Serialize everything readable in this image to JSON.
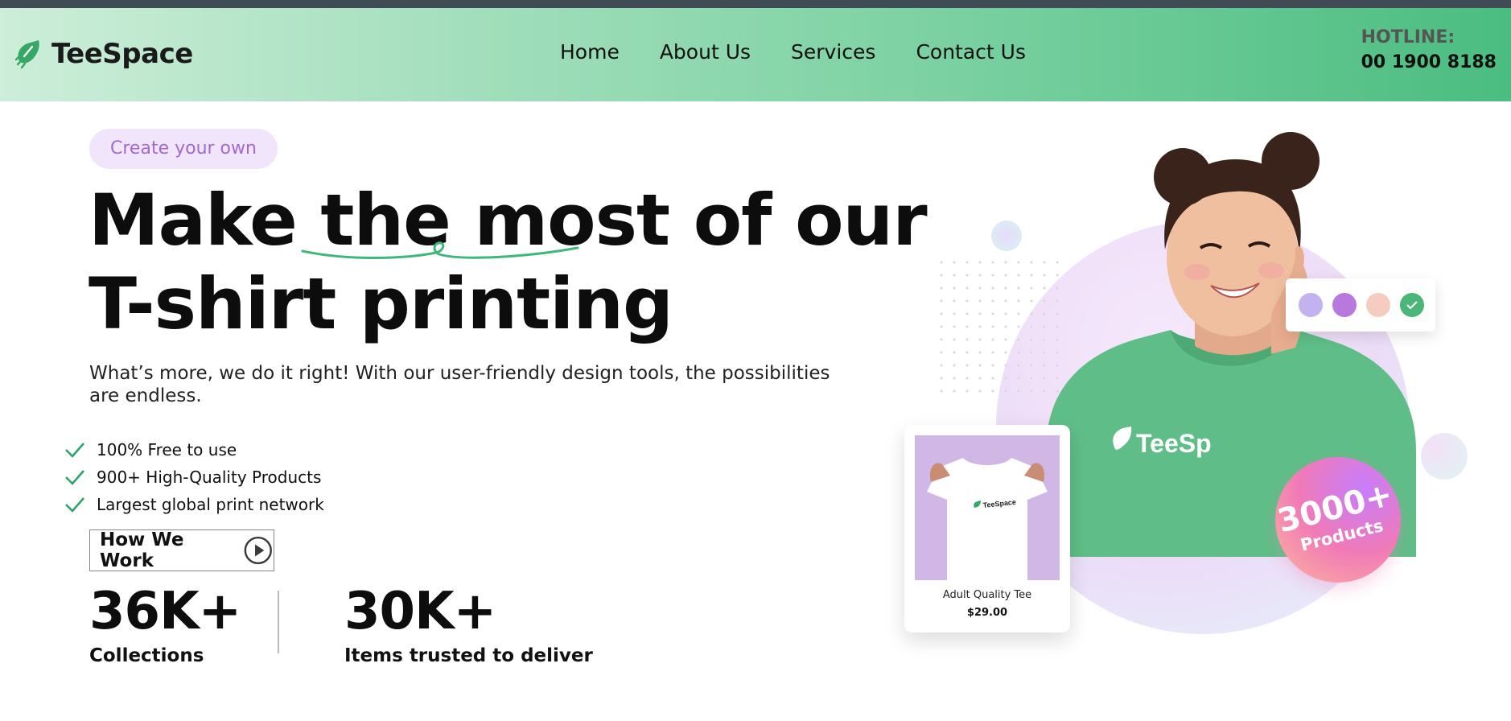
{
  "header": {
    "brand": "TeeSpace",
    "nav": [
      {
        "label": "Home"
      },
      {
        "label": "About Us"
      },
      {
        "label": "Services"
      },
      {
        "label": "Contact Us"
      }
    ],
    "hotline_label": "HOTLINE:",
    "hotline_number": "00 1900 8188"
  },
  "hero": {
    "badge": "Create your own",
    "title_line1": "Make the most of our",
    "title_line2": "T-shirt printing",
    "description": "What’s more, we do it right! With our user-friendly design tools, the possibilities are endless.",
    "features": [
      "100% Free to use",
      "900+ High-Quality Products",
      "Largest global print network"
    ],
    "cta_label": "How We Work"
  },
  "stats": [
    {
      "value": "36K+",
      "label": "Collections"
    },
    {
      "value": "30K+",
      "label": "Items trusted to deliver"
    }
  ],
  "illustration": {
    "hoodie_print": "TeeSp",
    "product_tee_print": "TeeSpace",
    "product_name": "Adult Quality Tee",
    "product_price": "$29.00",
    "products_badge_value": "3000+",
    "products_badge_label": "Products",
    "swatches": [
      "#c4b2f0",
      "#b878de",
      "#f5ccc0",
      "#4cb578"
    ]
  },
  "colors": {
    "accent_green": "#4bbd80",
    "badge_purple": "#a26ad0",
    "check_green": "#2ea36a"
  }
}
